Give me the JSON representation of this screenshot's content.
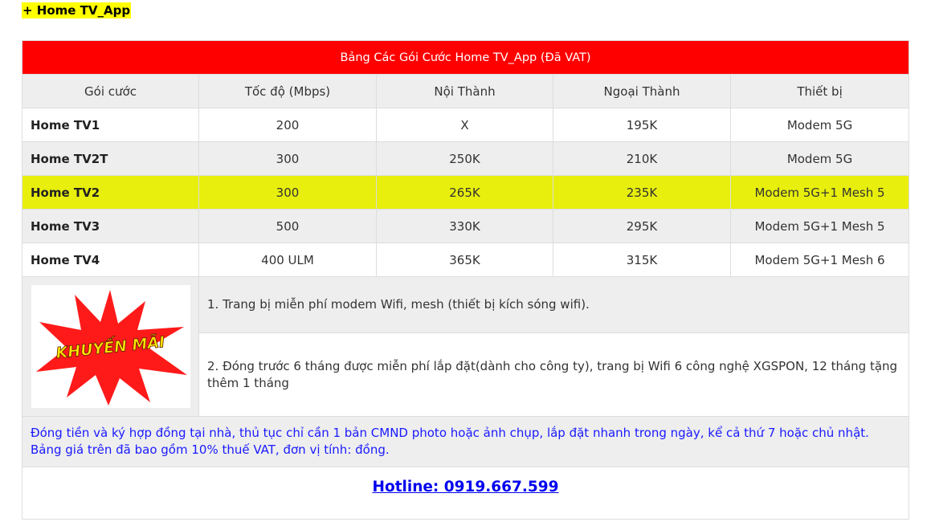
{
  "section_heading": "+ Home TV_App",
  "table": {
    "caption": "Bảng Các Gói Cước Home TV_App (Đã VAT)",
    "headers": [
      "Gói cước",
      "Tốc độ (Mbps)",
      "Nội Thành",
      "Ngoại Thành",
      "Thiết bị"
    ],
    "rows": [
      {
        "plan": "Home TV1",
        "speed": "200",
        "inner_city": "X",
        "outer_city": "195K",
        "device": "Modem 5G",
        "highlight": false
      },
      {
        "plan": "Home TV2T",
        "speed": "300",
        "inner_city": "250K",
        "outer_city": "210K",
        "device": "Modem 5G",
        "highlight": false
      },
      {
        "plan": "Home TV2",
        "speed": "300",
        "inner_city": "265K",
        "outer_city": "235K",
        "device": "Modem 5G+1 Mesh 5",
        "highlight": true
      },
      {
        "plan": "Home TV3",
        "speed": "500",
        "inner_city": "330K",
        "outer_city": "295K",
        "device": "Modem 5G+1 Mesh 5",
        "highlight": false
      },
      {
        "plan": "Home TV4",
        "speed": "400 ULM",
        "inner_city": "365K",
        "outer_city": "315K",
        "device": "Modem 5G+1 Mesh 6",
        "highlight": false
      }
    ],
    "highlight_color": "#e8ef0c",
    "caption_color": "#ff0000"
  },
  "promo": {
    "badge_text": "KHUYẾN MÃI",
    "badge_colors": {
      "burst": "#ff1a1a",
      "text": "#ffe600"
    },
    "notes": [
      "1. Trang bị miễn phí modem Wifi, mesh (thiết bị kích sóng wifi).",
      "2. Đóng trước 6 tháng được miễn phí lắp đặt(dành cho công ty), trang bị Wifi 6 công nghệ XGSPON, 12 tháng tặng thêm 1 tháng"
    ]
  },
  "disclaimer": "Đóng tiền và ký hợp đồng tại nhà, thủ tục chỉ cần 1 bản CMND photo hoặc ảnh chụp, lắp đặt nhanh trong ngày, kể cả thứ 7 hoặc chủ nhật. Bảng giá trên đã bao gồm 10% thuế VAT, đơn vị tính: đồng.",
  "hotline": {
    "label": "Hotline: 0919.667.599"
  }
}
